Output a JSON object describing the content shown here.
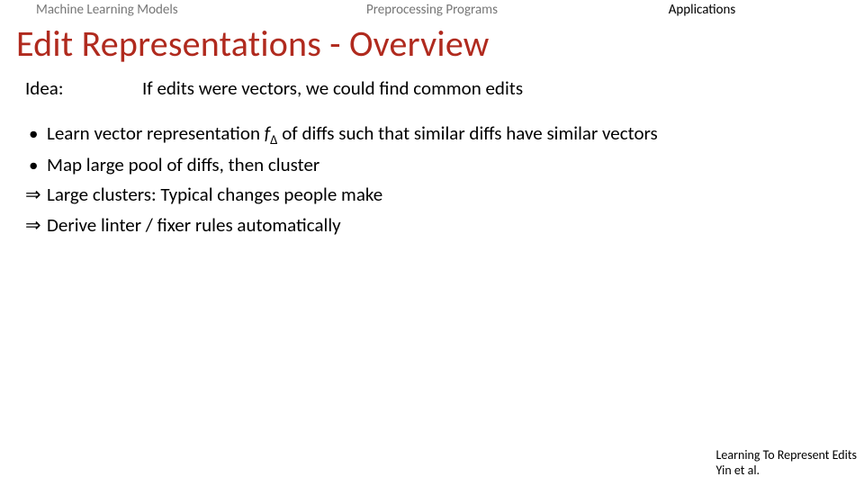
{
  "tabs": {
    "ml": "Machine Learning Models",
    "pp": "Preprocessing Programs",
    "app": "Applications"
  },
  "title": "Edit Representations - Overview",
  "idea": {
    "label": "Idea:",
    "text": "If edits were vectors, we could find common edits"
  },
  "bullets": {
    "b1_pre": "Learn vector representation ",
    "b1_math": "f",
    "b1_sub": "Δ",
    "b1_post": " of diffs such that similar diffs have similar vectors",
    "b2": "Map large pool of diffs, then cluster",
    "b3": "Large clusters: Typical changes people make",
    "b4": "Derive linter / fixer rules automatically"
  },
  "citation": {
    "line1": "Learning To Represent Edits",
    "line2": "Yin et al."
  }
}
